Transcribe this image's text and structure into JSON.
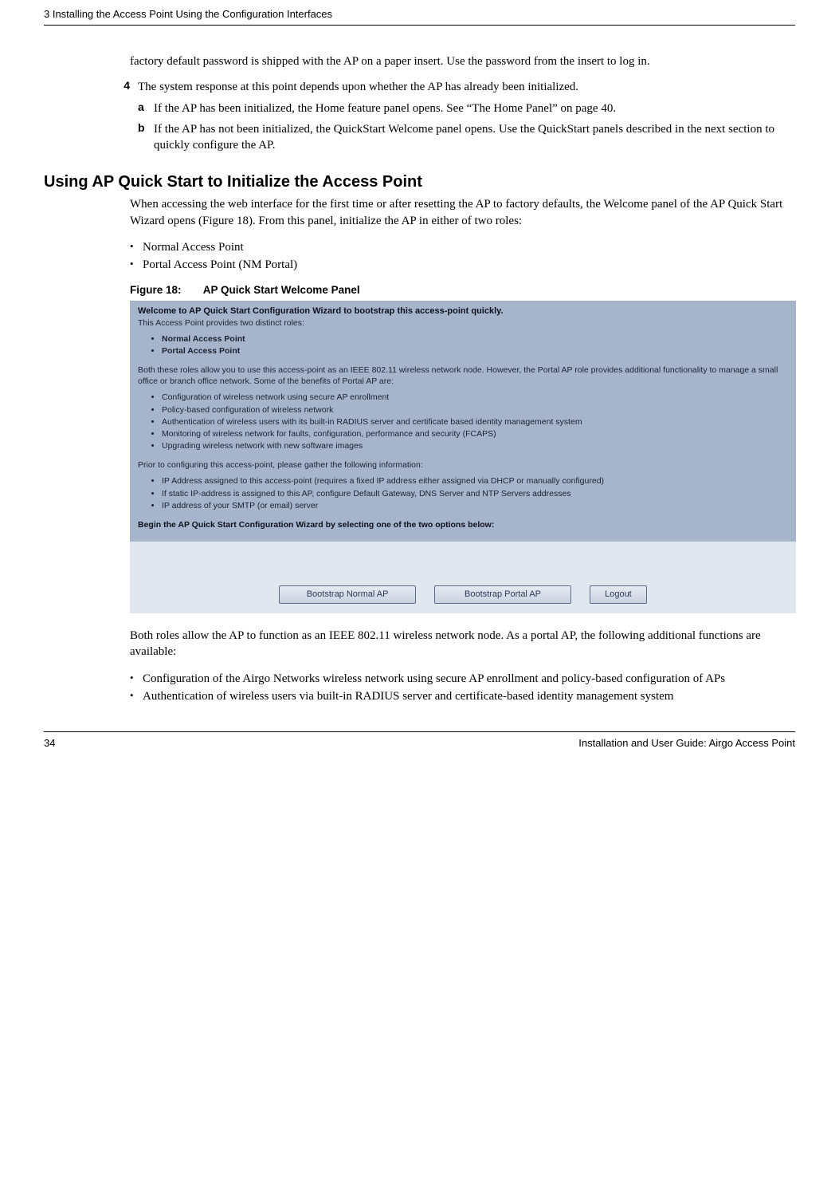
{
  "header": {
    "chapter": "3  Installing the Access Point Using the Configuration Interfaces"
  },
  "intro_para": "factory default password is shipped with the AP on a paper insert. Use the password from the insert to log in.",
  "step4": {
    "num": "4",
    "text": "The system response at this point depends upon whether the AP has already been initialized.",
    "a_letter": "a",
    "a_text": "If the AP has been initialized, the Home feature panel opens. See “The Home Panel” on page 40.",
    "b_letter": "b",
    "b_text": "If the AP has not been initialized, the QuickStart Welcome panel opens. Use the QuickStart panels described in the next section to quickly configure the AP."
  },
  "section_heading": "Using AP Quick Start to Initialize the Access Point",
  "section_para": "When accessing the web interface for the first time or after resetting the AP to factory defaults, the Welcome panel of the AP Quick Start Wizard opens (Figure 18). From this panel, initialize the AP in either of two roles:",
  "role_bullets": [
    "Normal Access Point",
    "Portal Access Point (NM Portal)"
  ],
  "figure": {
    "label": "Figure 18:",
    "title": "AP Quick Start Welcome Panel"
  },
  "wizard": {
    "title": "Welcome to AP Quick Start Configuration Wizard to bootstrap this access-point quickly.",
    "subtitle": "This Access Point provides two distinct roles:",
    "roles": [
      "Normal Access Point",
      "Portal Access Point"
    ],
    "roles_text": "Both these roles allow you to use this access-point as an IEEE 802.11 wireless network node. However, the Portal AP role provides additional functionality to manage a small office or branch office network. Some of the benefits of Portal AP are:",
    "benefits": [
      "Configuration of wireless network using secure AP enrollment",
      "Policy-based configuration of wireless network",
      "Authentication of wireless users with its built-in RADIUS server and certificate based identity management system",
      "Monitoring of wireless network for faults, configuration, performance and security (FCAPS)",
      "Upgrading wireless network with new software images"
    ],
    "prior_text": "Prior to configuring this access-point, please gather the following information:",
    "info_items": [
      "IP Address assigned to this access-point (requires a fixed IP address either assigned via DHCP or manually configured)",
      "If static IP-address is assigned to this AP, configure Default Gateway, DNS Server and NTP Servers addresses",
      "IP address of your SMTP (or email) server"
    ],
    "begin_text": "Begin the AP Quick Start Configuration Wizard by selecting one of the two options below:",
    "buttons": {
      "normal": "Bootstrap Normal AP",
      "portal": "Bootstrap Portal AP",
      "logout": "Logout"
    }
  },
  "after_figure_para": "Both roles allow the AP to function as an IEEE 802.11 wireless network node. As a portal AP, the following additional functions are available:",
  "after_bullets": [
    "Configuration of the Airgo Networks wireless network using secure AP enrollment and policy-based configuration of APs",
    "Authentication of wireless users via built-in RADIUS server and certificate-based identity management system"
  ],
  "footer": {
    "page": "34",
    "doc": "Installation and User Guide: Airgo Access Point"
  }
}
